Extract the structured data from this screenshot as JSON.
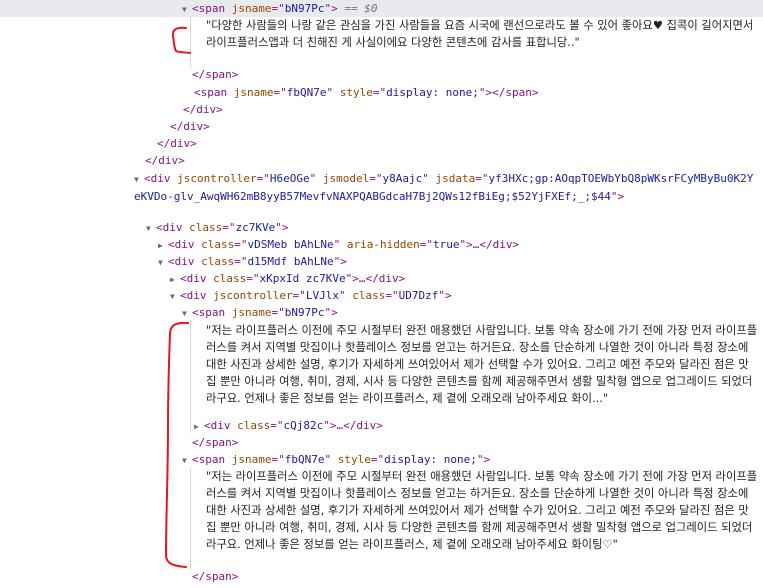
{
  "lines": {
    "l1": {
      "tag_open": "<span ",
      "attr": "jsname",
      "eq": "=\"",
      "val": "bN97Pc",
      "close": "\">",
      "dollar": " == $0"
    },
    "l1_text": "\"다양한 사람들의 나랑 같은 관심을 가진 사람들을 요즘 시국에 랜선으로라도 볼 수 있어 좋아요♥ 집콕이 길어지면서 라이프플러스앱과 더 친해진 게 사실이에요 다양한 콘텐츠에 감사를 표합니당..\"",
    "l2": "</span>",
    "l3": {
      "tag_open": "<span ",
      "attr1": "jsname",
      "val1": "fbQN7e",
      "attr2": "style",
      "val2": "display: none;",
      "tail": "></span>"
    },
    "l4": "</div>",
    "l5": "</div>",
    "l6": "</div>",
    "l7": "</div>",
    "l8": {
      "tag_open": "<div ",
      "a1": "jscontroller",
      "v1": "H6eOGe",
      "a2": "jsmodel",
      "v2": "y8Aajc",
      "a3": "jsdata",
      "v3": "yf3HXc;gp:AOqpTOEWbYbQ8pWKsrFCyMByBu0K2YeKVDo-glv_AwqWH62mB8yyB57MevfvNAXPQABGdcaH7Bj2QWs12fBiEg;$52YjFXEf;_;$44",
      "close": "\">"
    },
    "l9": {
      "tag": "<div ",
      "attr": "class",
      "val": "zc7KVe",
      "close": "\">"
    },
    "l10": {
      "tag": "<div ",
      "a1": "class",
      "v1": "vDSMeb bAhLNe",
      "a2": "aria-hidden",
      "v2": "true",
      "tail": ">…</div>"
    },
    "l11": {
      "tag": "<div ",
      "attr": "class",
      "val": "d15Mdf bAhLNe",
      "close": "\">"
    },
    "l12": {
      "tag": "<div ",
      "attr": "class",
      "val": "xKpxId zc7KVe",
      "tail": ">…</div>"
    },
    "l13": {
      "tag": "<div ",
      "a1": "jscontroller",
      "v1": "LVJlx",
      "a2": "class",
      "v2": "UD7Dzf",
      "close": "\">"
    },
    "l14": {
      "tag": "<span ",
      "attr": "jsname",
      "val": "bN97Pc",
      "close": "\">"
    },
    "l14_text": "\"저는 라이프플러스 이전에 주모 시절부터 완전 애용했던 사람입니다. 보통 약속 장소에 가기 전에 가장 먼저 라이프플러스를 켜서 지역별 맛집이나 핫플레이스 정보를 얻고는 하거든요. 장소를 단순하게 나열한 것이 아니라 특정 장소에 대한 사진과 상세한 설명, 후기가 자세하게 쓰여있어서 제가 선택할 수가 있어요. 그리고 예전 주모와 달라진 점은 맛집 뿐만 아니라 여행, 취미, 경제, 시사 등 다양한 콘텐츠를 함께 제공해주면서 생활 밀착형 앱으로 업그레이드 되었더라구요. 언제나 좋은 정보를 얻는 라이프플러스, 제 곁에 오래오래 남아주세요 화이...\"",
    "l15": {
      "tag": "<div ",
      "attr": "class",
      "val": "cQj82c",
      "tail": ">…</div>"
    },
    "l16": "</span>",
    "l17": {
      "tag": "<span ",
      "a1": "jsname",
      "v1": "fbQN7e",
      "a2": "style",
      "v2": "display: none;",
      "close": "\">"
    },
    "l17_text": "\"저는 라이프플러스 이전에 주모 시절부터 완전 애용했던 사람입니다. 보통 약속 장소에 가기 전에 가장 먼저 라이프플러스를 켜서 지역별 맛집이나 핫플레이스 정보를 얻고는 하거든요. 장소를 단순하게 나열한 것이 아니라 특정 장소에 대한 사진과 상세한 설명, 후기가 자세하게 쓰여있어서 제가 선택할 수가 있어요. 그리고 예전 주모와 달라진 점은 맛집 뿐만 아니라 여행, 취미, 경제, 시사 등 다양한 콘텐츠를 함께 제공해주면서 생활 밀착형 앱으로 업그레이드 되었더라구요. 언제나 좋은 정보를 얻는 라이프플러스, 제 곁에 오래오래 남아주세요 화이팅♡\"",
    "l18": "</span>"
  },
  "colors": {
    "tag": "#881280",
    "attr": "#994500",
    "value": "#1a1aa6",
    "marker": "#e8141c"
  },
  "icons": {
    "expanded": "triangle-down-icon",
    "collapsed": "triangle-right-icon"
  }
}
